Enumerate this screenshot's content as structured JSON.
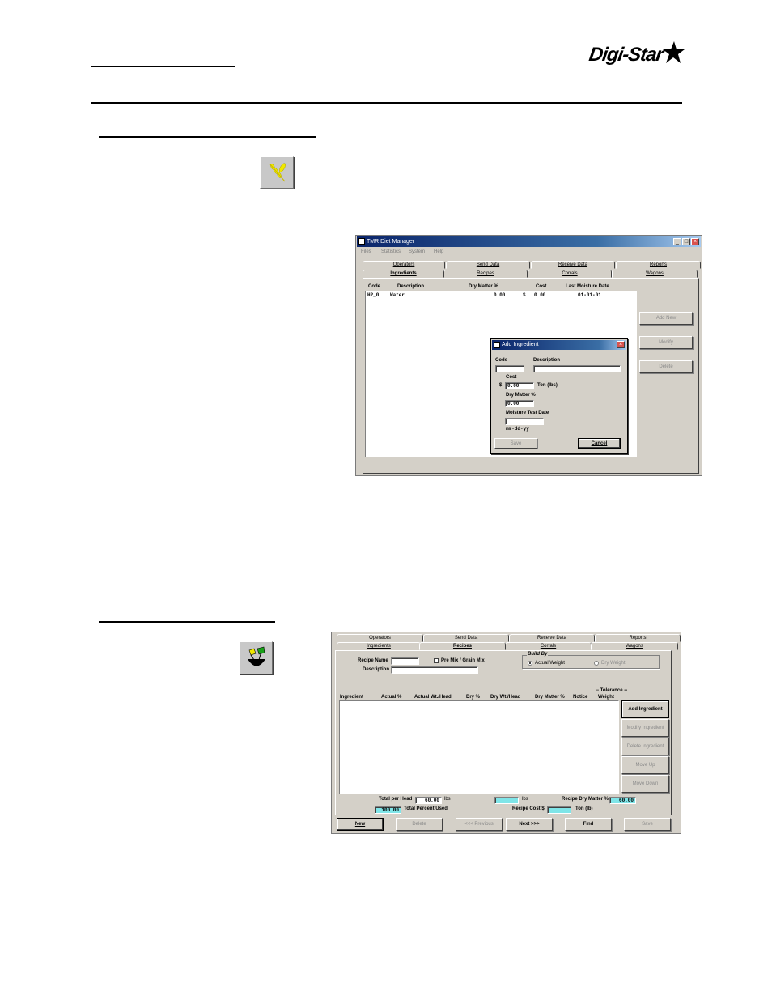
{
  "logo": {
    "text": "Digi-Star"
  },
  "diet_manager_window": {
    "title": "TMR Diet Manager",
    "menu": [
      "Files",
      "Statistics",
      "System",
      "Help"
    ],
    "tabs_row1": [
      "Operators",
      "Send Data",
      "Receive Data",
      "Reports"
    ],
    "tabs_row2": [
      "Ingredients",
      "Recipes",
      "Corrals",
      "Wagons"
    ],
    "active_tab": "Ingredients",
    "columns": [
      "Code",
      "Description",
      "Dry Matter %",
      "Cost",
      "Last Moisture Date"
    ],
    "rows": [
      {
        "code": "H2_0",
        "description": "Water",
        "dry_matter": "0.00",
        "currency": "$",
        "cost": "0.00",
        "date": "01-01-01"
      }
    ],
    "buttons": {
      "add_new": "Add New",
      "modify": "Modify",
      "delete": "Delete"
    }
  },
  "add_ingredient_dialog": {
    "title": "Add Ingredient",
    "code_label": "Code",
    "description_label": "Description",
    "cost_label": "Cost",
    "currency": "$",
    "cost_value": "0.00",
    "cost_unit": "Ton (lbs)",
    "dry_matter_label": "Dry Matter %",
    "dry_matter_value": "0.00",
    "moisture_label": "Moisture Test Date",
    "date_format": "mm-dd-yy",
    "save": "Save",
    "cancel": "Cancel"
  },
  "recipes_window": {
    "tabs_row1": [
      "Operators",
      "Send Data",
      "Receive Data",
      "Reports"
    ],
    "tabs_row2": [
      "Ingredients",
      "Recipes",
      "Corrals",
      "Wagons"
    ],
    "active_tab": "Recipes",
    "recipe_name_label": "Recipe Name",
    "premix_label": "Pre Mix / Grain Mix",
    "description_label": "Description",
    "build_by_label": "Build By",
    "actual_weight": "Actual Weight",
    "dry_weight": "Dry Weight",
    "tolerance_label": "-- Tolerance --",
    "columns": [
      "Ingredient",
      "Actual %",
      "Actual Wt./Head",
      "Dry %",
      "Dry Wt./Head",
      "Dry Matter %",
      "Notice",
      "Weight"
    ],
    "side_buttons": [
      "Add Ingredient",
      "Modify Ingredient",
      "Delete Ingredient",
      "Move Up",
      "Move Down"
    ],
    "total_per_head_label": "Total per Head",
    "total_per_head_value": "60.00",
    "lbs": "lbs",
    "dry_lbs": "lbs",
    "recipe_dm_label": "Recipe Dry Matter %",
    "recipe_dm_value": "60.00",
    "percent_used_value": "100.00",
    "percent_used_label": "Total Percent Used",
    "recipe_cost_label": "Recipe Cost $",
    "ton_label": "Ton (lb)",
    "bottom_buttons": [
      "New",
      "Delete",
      "<<< Previous",
      "Next >>>",
      "Find",
      "Save"
    ]
  },
  "colors": {
    "title_blue": "#0a246a",
    "window_gray": "#d4d0c8",
    "icon_yellow": "#f0e800",
    "cyan_field": "#7fe5e8"
  }
}
